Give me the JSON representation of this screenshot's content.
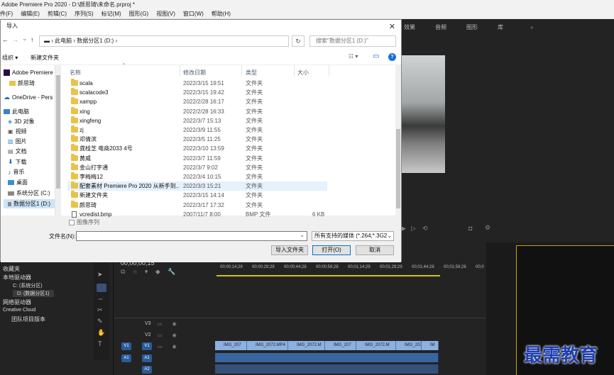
{
  "app": {
    "title": "Adobe Premiere Pro 2020 - D:\\颜思琦\\未命名.prproj *",
    "menu": [
      "件(F)",
      "编辑(E)",
      "剪辑(C)",
      "序列(S)",
      "标记(M)",
      "图形(G)",
      "视图(V)",
      "窗口(W)",
      "帮助(H)"
    ],
    "workspaces": [
      "效果",
      "音频",
      "图形",
      "库"
    ],
    "ws_more": "»"
  },
  "dialog": {
    "title": "导入",
    "close": "✕",
    "nav": {
      "back": "←",
      "forward": "→",
      "up": "↑",
      "dropdown": "⌄"
    },
    "breadcrumb": "▬  ›  此电脑  ›  数据分区1 (D:)  ›",
    "refresh": "↻",
    "search_placeholder": "搜索\"数据分区1 (D:)\"",
    "organize": "组织 ▾",
    "new_folder": "新建文件夹",
    "view_icon": "☷ ▾",
    "pane_icon": "▭",
    "help_icon": "?",
    "sidebar": [
      "Adobe Premiere",
      "颜思琦",
      "OneDrive - Pers",
      "此电脑",
      "3D 对象",
      "视频",
      "图片",
      "文档",
      "下载",
      "音乐",
      "桌面",
      "系统分区 (C:)",
      "数据分区1 (D:)"
    ],
    "columns": {
      "name": "名称",
      "date": "修改日期",
      "type": "类型",
      "size": "大小"
    },
    "files": [
      {
        "name": "scala",
        "date": "2022/3/15 19:51",
        "type": "文件夹",
        "size": ""
      },
      {
        "name": "scalacode3",
        "date": "2022/3/15 19:42",
        "type": "文件夹",
        "size": ""
      },
      {
        "name": "xampp",
        "date": "2022/2/28 16:17",
        "type": "文件夹",
        "size": ""
      },
      {
        "name": "xing",
        "date": "2022/2/28 16:33",
        "type": "文件夹",
        "size": ""
      },
      {
        "name": "xingfeng",
        "date": "2022/3/7 15:13",
        "type": "文件夹",
        "size": ""
      },
      {
        "name": "zj",
        "date": "2022/3/9 11:55",
        "type": "文件夹",
        "size": ""
      },
      {
        "name": "邓倩滨",
        "date": "2022/3/5 11:25",
        "type": "文件夹",
        "size": ""
      },
      {
        "name": "龚桂芝 电商2033 4号",
        "date": "2022/3/10 13:59",
        "type": "文件夹",
        "size": ""
      },
      {
        "name": "黄威",
        "date": "2022/3/7 11:59",
        "type": "文件夹",
        "size": ""
      },
      {
        "name": "金山打字通",
        "date": "2022/3/7 9:02",
        "type": "文件夹",
        "size": ""
      },
      {
        "name": "李梅梅12",
        "date": "2022/3/4 10:15",
        "type": "文件夹",
        "size": ""
      },
      {
        "name": "配套素材 Premiere Pro 2020 从新手到...",
        "date": "2022/3/3 15:21",
        "type": "文件夹",
        "size": ""
      },
      {
        "name": "新建文件夹",
        "date": "2022/3/15 14:14",
        "type": "文件夹",
        "size": ""
      },
      {
        "name": "颜思琦",
        "date": "2022/3/17 17:32",
        "type": "文件夹",
        "size": ""
      },
      {
        "name": "vcredist.bmp",
        "date": "2007/11/7 8:00",
        "type": "BMP 文件",
        "size": "6 KB"
      }
    ],
    "image_sequence": "图像序列",
    "filename_label": "文件名(N):",
    "filename_value": "",
    "filetype": "所有支持的媒体 (*.264;*.3G2;*",
    "import_folder": "导入文件夹",
    "open": "打开(O)",
    "cancel": "取消"
  },
  "left_panel": {
    "items": [
      "收藏夹",
      "本地驱动器",
      "C: (系统分区)",
      "D: (数据分区1)",
      "网络驱动器",
      "Creative Cloud",
      "团队项目版本"
    ]
  },
  "timeline": {
    "timecode": "00;00;00;15",
    "ruler": [
      "00;00;14;29",
      "00;00;29;29",
      "00;00;44;28",
      "00;00;59;28",
      "00;01;14;29",
      "00;01;29;29",
      "00;01;44;28",
      "00;01;59;28",
      "00;0"
    ],
    "tracks": [
      "V3",
      "V2",
      "V1",
      "A1",
      "A2"
    ],
    "src_v": "V1",
    "src_a": "A1",
    "clips": [
      "IMG_207",
      "IMG_2072.MP4",
      "IMG_2072.M",
      "IMG_207",
      "IMG_2072.M",
      "IMG_207",
      "IM"
    ]
  },
  "watermark": "最需教育"
}
